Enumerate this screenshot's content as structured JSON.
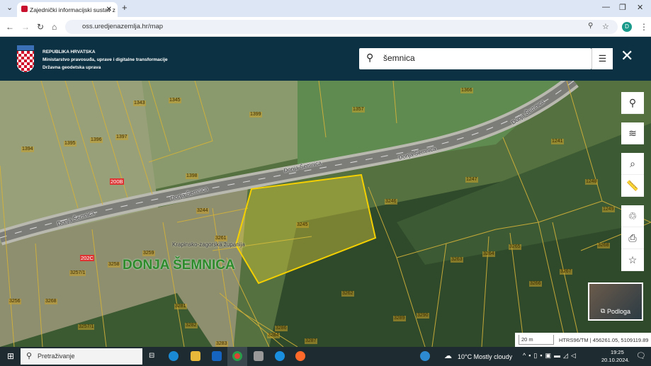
{
  "browser": {
    "tab_title": "Zajednički informacijski sustav z",
    "url": "oss.uredjenazemlja.hr/map",
    "profile": "D"
  },
  "header": {
    "line1": "REPUBLIKA HRVATSKA",
    "line2": "Ministarstvo pravosuđa, uprave i digitalne transformacije",
    "line3": "Državna geodetska uprava",
    "search_value": "šemnica"
  },
  "map": {
    "parcels": [
      "1394",
      "1395",
      "1396",
      "1397",
      "1343",
      "1345",
      "1399",
      "1357",
      "1366",
      "1241",
      "1398",
      "1247",
      "1248",
      "1249",
      "3244",
      "3245",
      "3246",
      "3261",
      "3259",
      "3258",
      "3257/1",
      "3256",
      "3268",
      "3257/1",
      "3262",
      "3263",
      "3264",
      "3265",
      "3266",
      "3267",
      "3268",
      "3281",
      "3282",
      "3283",
      "3284",
      "3286",
      "3287",
      "3289",
      "3290"
    ],
    "houses": [
      "200B",
      "202C"
    ],
    "roads": [
      "Donja Šemnica",
      "Donja Šemnica",
      "Donja Šemnica",
      "Donja Šemnica",
      "Donja Šemnica"
    ],
    "county": "Krapinsko-zagorska županija",
    "place": "DONJA ŠEMNICA",
    "selected_color": "#f5d000",
    "basemap_label": "Podloga",
    "scale": "20 m",
    "coords": "HTRS96/TM | 456261.05, 5109119.89"
  },
  "tools": [
    "location-icon",
    "layers-icon",
    "search-location-icon",
    "ruler-icon",
    "share-icon",
    "print-icon",
    "star-icon"
  ],
  "taskbar": {
    "search": "Pretraživanje",
    "weather": "10°C  Mostly cloudy",
    "time": "19:25",
    "date": "20.10.2024."
  }
}
